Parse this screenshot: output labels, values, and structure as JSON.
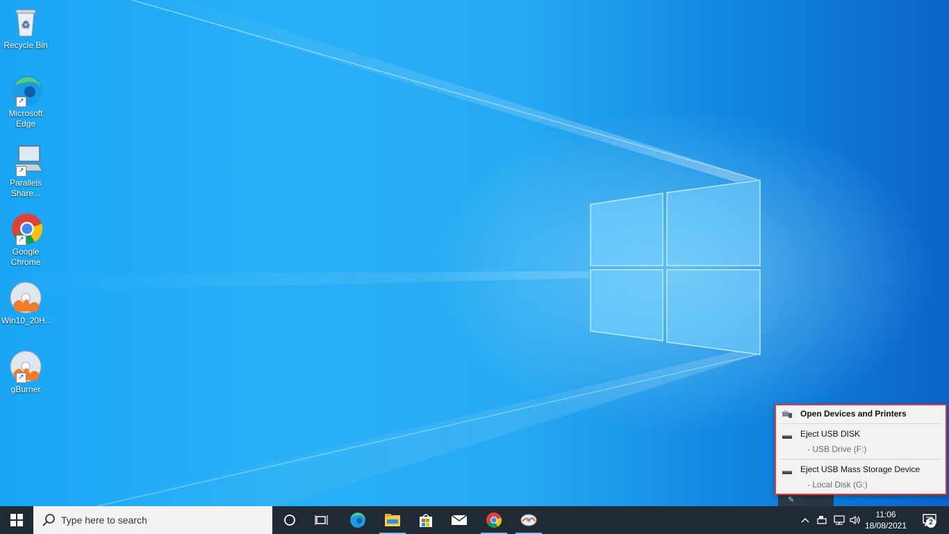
{
  "desktop": {
    "icons": [
      {
        "label": "Recycle Bin",
        "icon": "recycle-bin-icon"
      },
      {
        "label": "Microsoft Edge",
        "icon": "edge-icon"
      },
      {
        "label": "Parallels Share...",
        "icon": "monitor-icon"
      },
      {
        "label": "Google Chrome",
        "icon": "chrome-icon"
      },
      {
        "label": "Win10_20H...",
        "icon": "disc-image-icon"
      },
      {
        "label": "gBurner",
        "icon": "disc-burner-icon"
      }
    ]
  },
  "usb_menu": {
    "open_devices": "Open Devices and Printers",
    "eject_usb_disk": "Eject USB DISK",
    "usb_disk_sub": "-   USB Drive (F:)",
    "eject_mass_storage": "Eject USB Mass Storage Device",
    "mass_storage_sub": "-   Local Disk (G:)",
    "highlight_color": "#e53935"
  },
  "taskbar": {
    "search_placeholder": "Type here to search",
    "pinned": [
      "cortana-icon",
      "task-view-icon",
      "edge-icon",
      "file-explorer-icon",
      "store-icon",
      "mail-icon",
      "chrome-icon",
      "gburner-icon"
    ],
    "clock_time": "11:06",
    "clock_date": "18/08/2021",
    "notification_count": "2"
  }
}
